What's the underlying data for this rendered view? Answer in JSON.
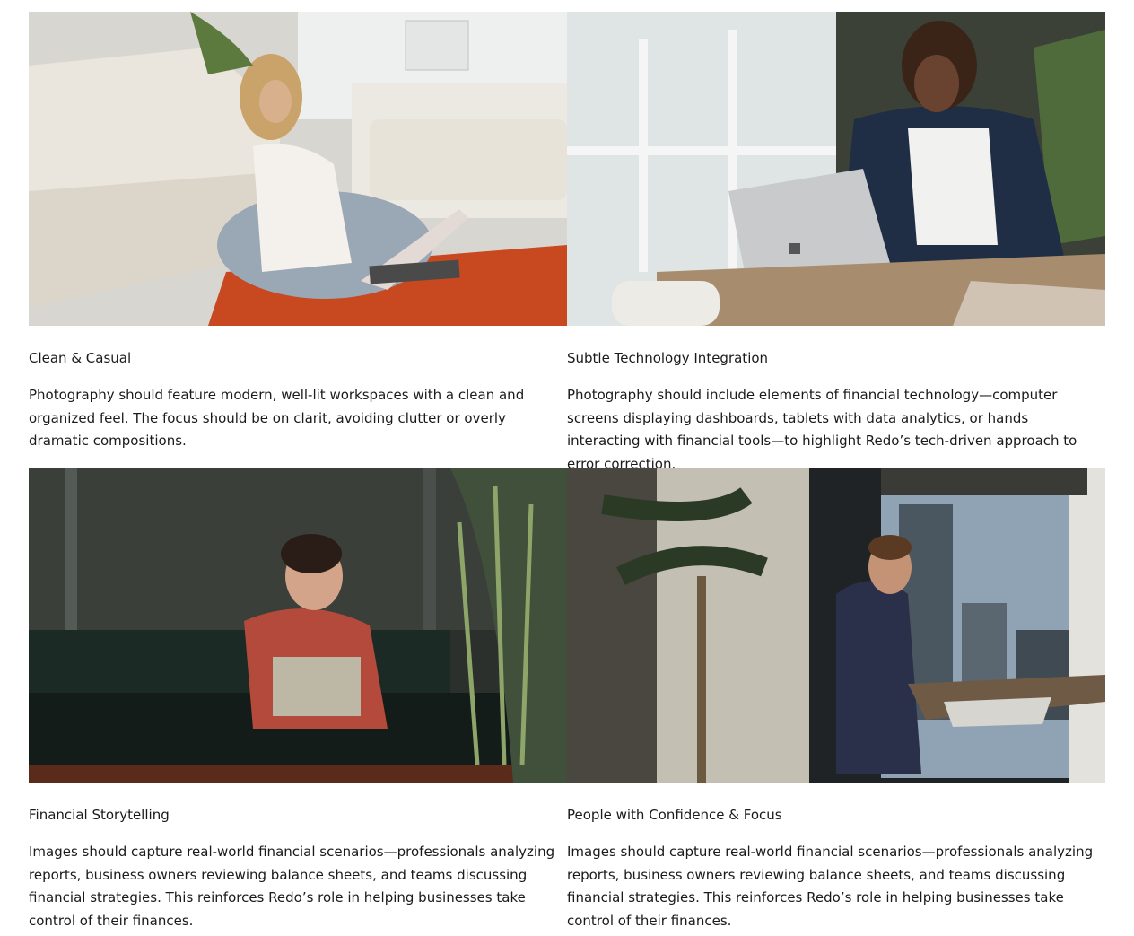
{
  "cards": [
    {
      "title": "Clean & Casual",
      "description": "Photography should feature modern, well-lit workspaces with a clean and organized feel. The focus should be on clarit, avoiding clutter or overly dramatic compositions."
    },
    {
      "title": "Subtle Technology Integration",
      "description": "Photography should include elements of financial technology—computer screens displaying dashboards, tablets with data analytics, or hands interacting with financial tools—to highlight Redo’s tech-driven approach to error correction."
    },
    {
      "title": "Financial Storytelling",
      "description": "Images should capture real-world financial scenarios—professionals analyzing reports, business owners reviewing balance sheets, and teams discussing financial strategies. This reinforces Redo’s role in helping businesses take control of their finances."
    },
    {
      "title": "People with Confidence & Focus",
      "description": "Images should capture real-world financial scenarios—professionals analyzing reports, business owners reviewing balance sheets, and teams discussing financial strategies. This reinforces Redo’s role in helping businesses take control of their finances."
    }
  ]
}
